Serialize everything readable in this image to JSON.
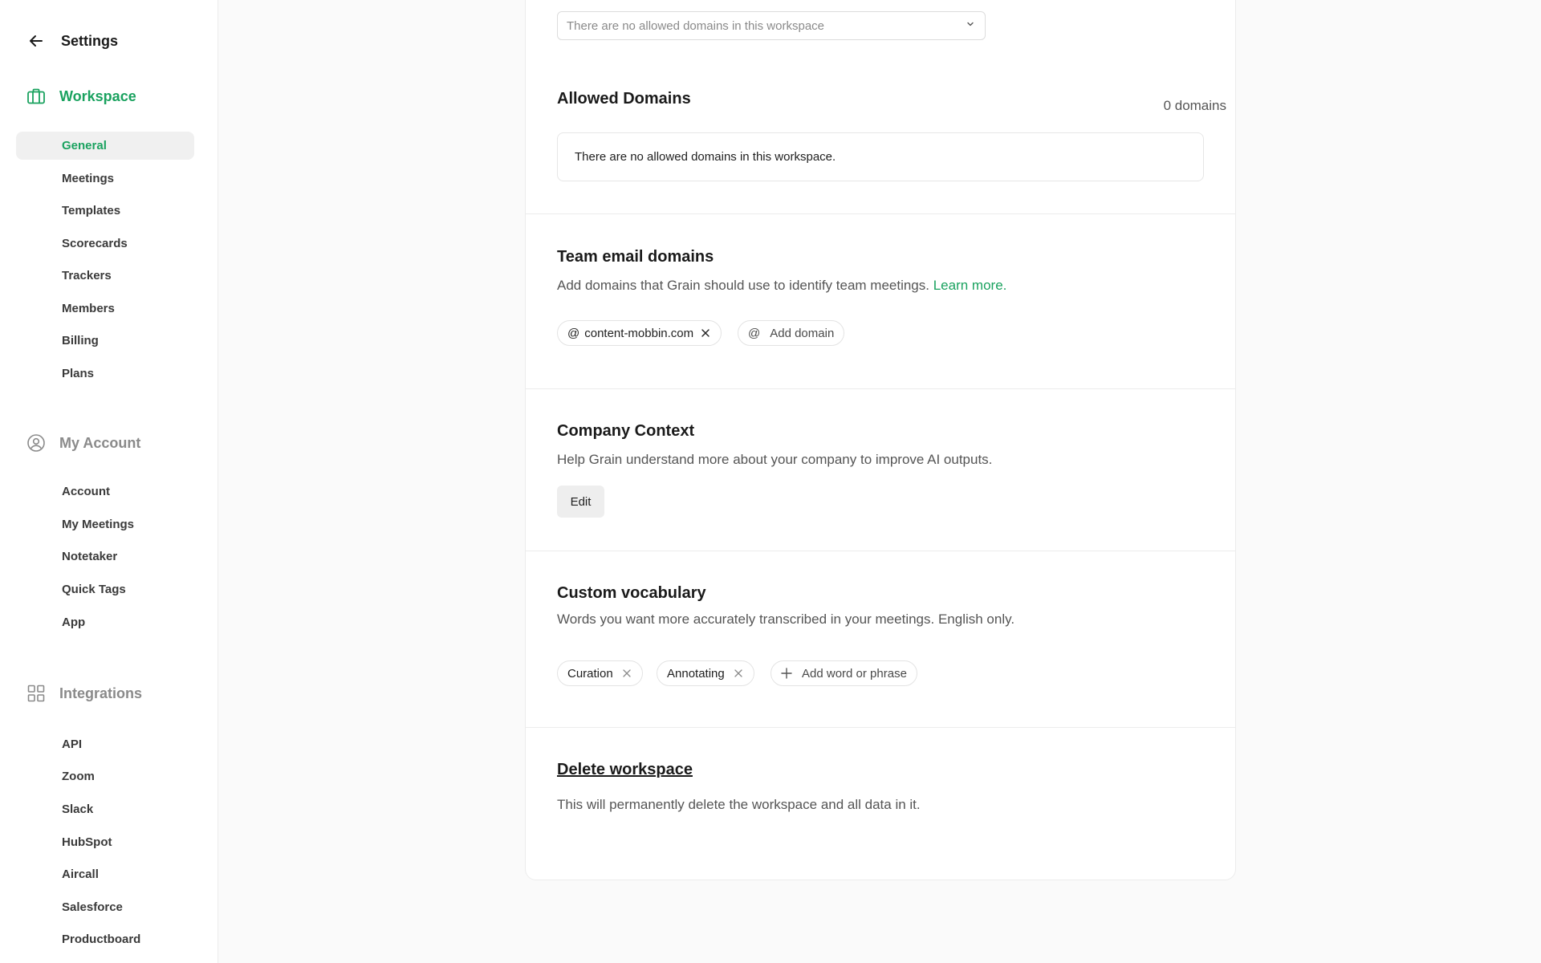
{
  "sidebar": {
    "title": "Settings",
    "sections": {
      "workspace": {
        "label": "Workspace",
        "items": [
          "General",
          "Meetings",
          "Templates",
          "Scorecards",
          "Trackers",
          "Members",
          "Billing",
          "Plans"
        ]
      },
      "account": {
        "label": "My Account",
        "items": [
          "Account",
          "My Meetings",
          "Notetaker",
          "Quick Tags",
          "App"
        ]
      },
      "integrations": {
        "label": "Integrations",
        "items": [
          "API",
          "Zoom",
          "Slack",
          "HubSpot",
          "Aircall",
          "Salesforce",
          "Productboard"
        ]
      }
    },
    "active_item": "General"
  },
  "main": {
    "select_placeholder": "There are no allowed domains in this workspace",
    "allowed_domains": {
      "title": "Allowed Domains",
      "count": "0 domains",
      "empty": "There are no allowed domains in this workspace."
    },
    "team_email": {
      "title": "Team email domains",
      "desc": "Add domains that Grain should use to identify team meetings.",
      "link": "Learn more.",
      "domains": [
        "content-mobbin.com"
      ],
      "add_label": "Add domain"
    },
    "company_context": {
      "title": "Company Context",
      "desc": "Help Grain understand more about your company to improve AI outputs.",
      "button": "Edit"
    },
    "vocabulary": {
      "title": "Custom vocabulary",
      "desc": "Words you want more accurately transcribed in your meetings. English only.",
      "words": [
        "Curation",
        "Annotating"
      ],
      "add_label": "Add word or phrase"
    },
    "delete": {
      "title": "Delete workspace",
      "desc": "This will permanently delete the workspace and all data in it."
    }
  },
  "colors": {
    "accent": "#1aa25f",
    "muted": "#8a8a8a"
  }
}
